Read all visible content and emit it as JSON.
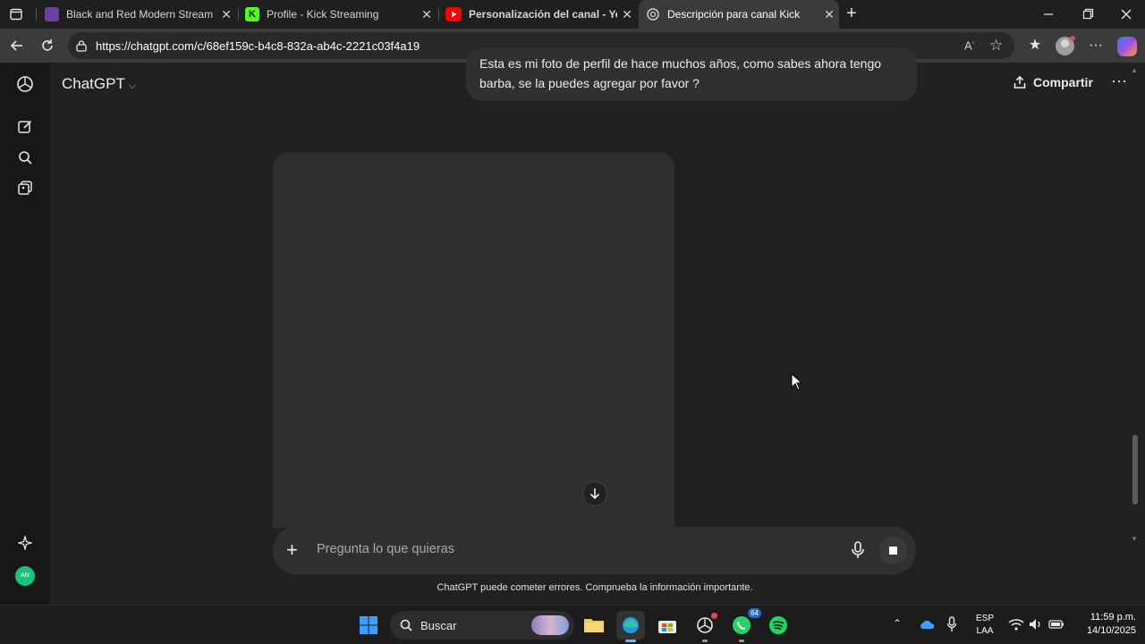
{
  "browser": {
    "tabs": [
      {
        "title": "Black and Red Modern Stream Tw",
        "favicon_color": "#6b3fa0",
        "active": false
      },
      {
        "title": "Profile - Kick Streaming",
        "favicon_color": "#53fc18",
        "active": false
      },
      {
        "title": "Personalización del canal - YouTu",
        "favicon_color": "#ff0000",
        "active": false
      },
      {
        "title": "Descripción para canal Kick",
        "favicon_color": "#cccccc",
        "active": true
      }
    ],
    "url": "https://chatgpt.com/c/68ef159c-b4c8-832a-ab4c-2221c03f4a19"
  },
  "chatgpt": {
    "model_label": "ChatGPT",
    "share_label": "Compartir",
    "user_message": "Esta es mi foto de perfil de hace muchos años, como sabes ahora tengo barba, se la puedes agregar por favor ?",
    "composer_placeholder": "Pregunta lo que quieras",
    "disclaimer": "ChatGPT puede cometer errores. Comprueba la información importante.",
    "avatar_initials": "AN"
  },
  "taskbar": {
    "search_label": "Buscar",
    "lang_line1": "ESP",
    "lang_line2": "LAA",
    "time": "11:59 p.m.",
    "date": "14/10/2025",
    "whatsapp_badge": "64"
  },
  "colors": {
    "app_bg": "#212121",
    "rail_bg": "#171717",
    "bubble_bg": "#303030",
    "accent_green": "#19c37d"
  }
}
